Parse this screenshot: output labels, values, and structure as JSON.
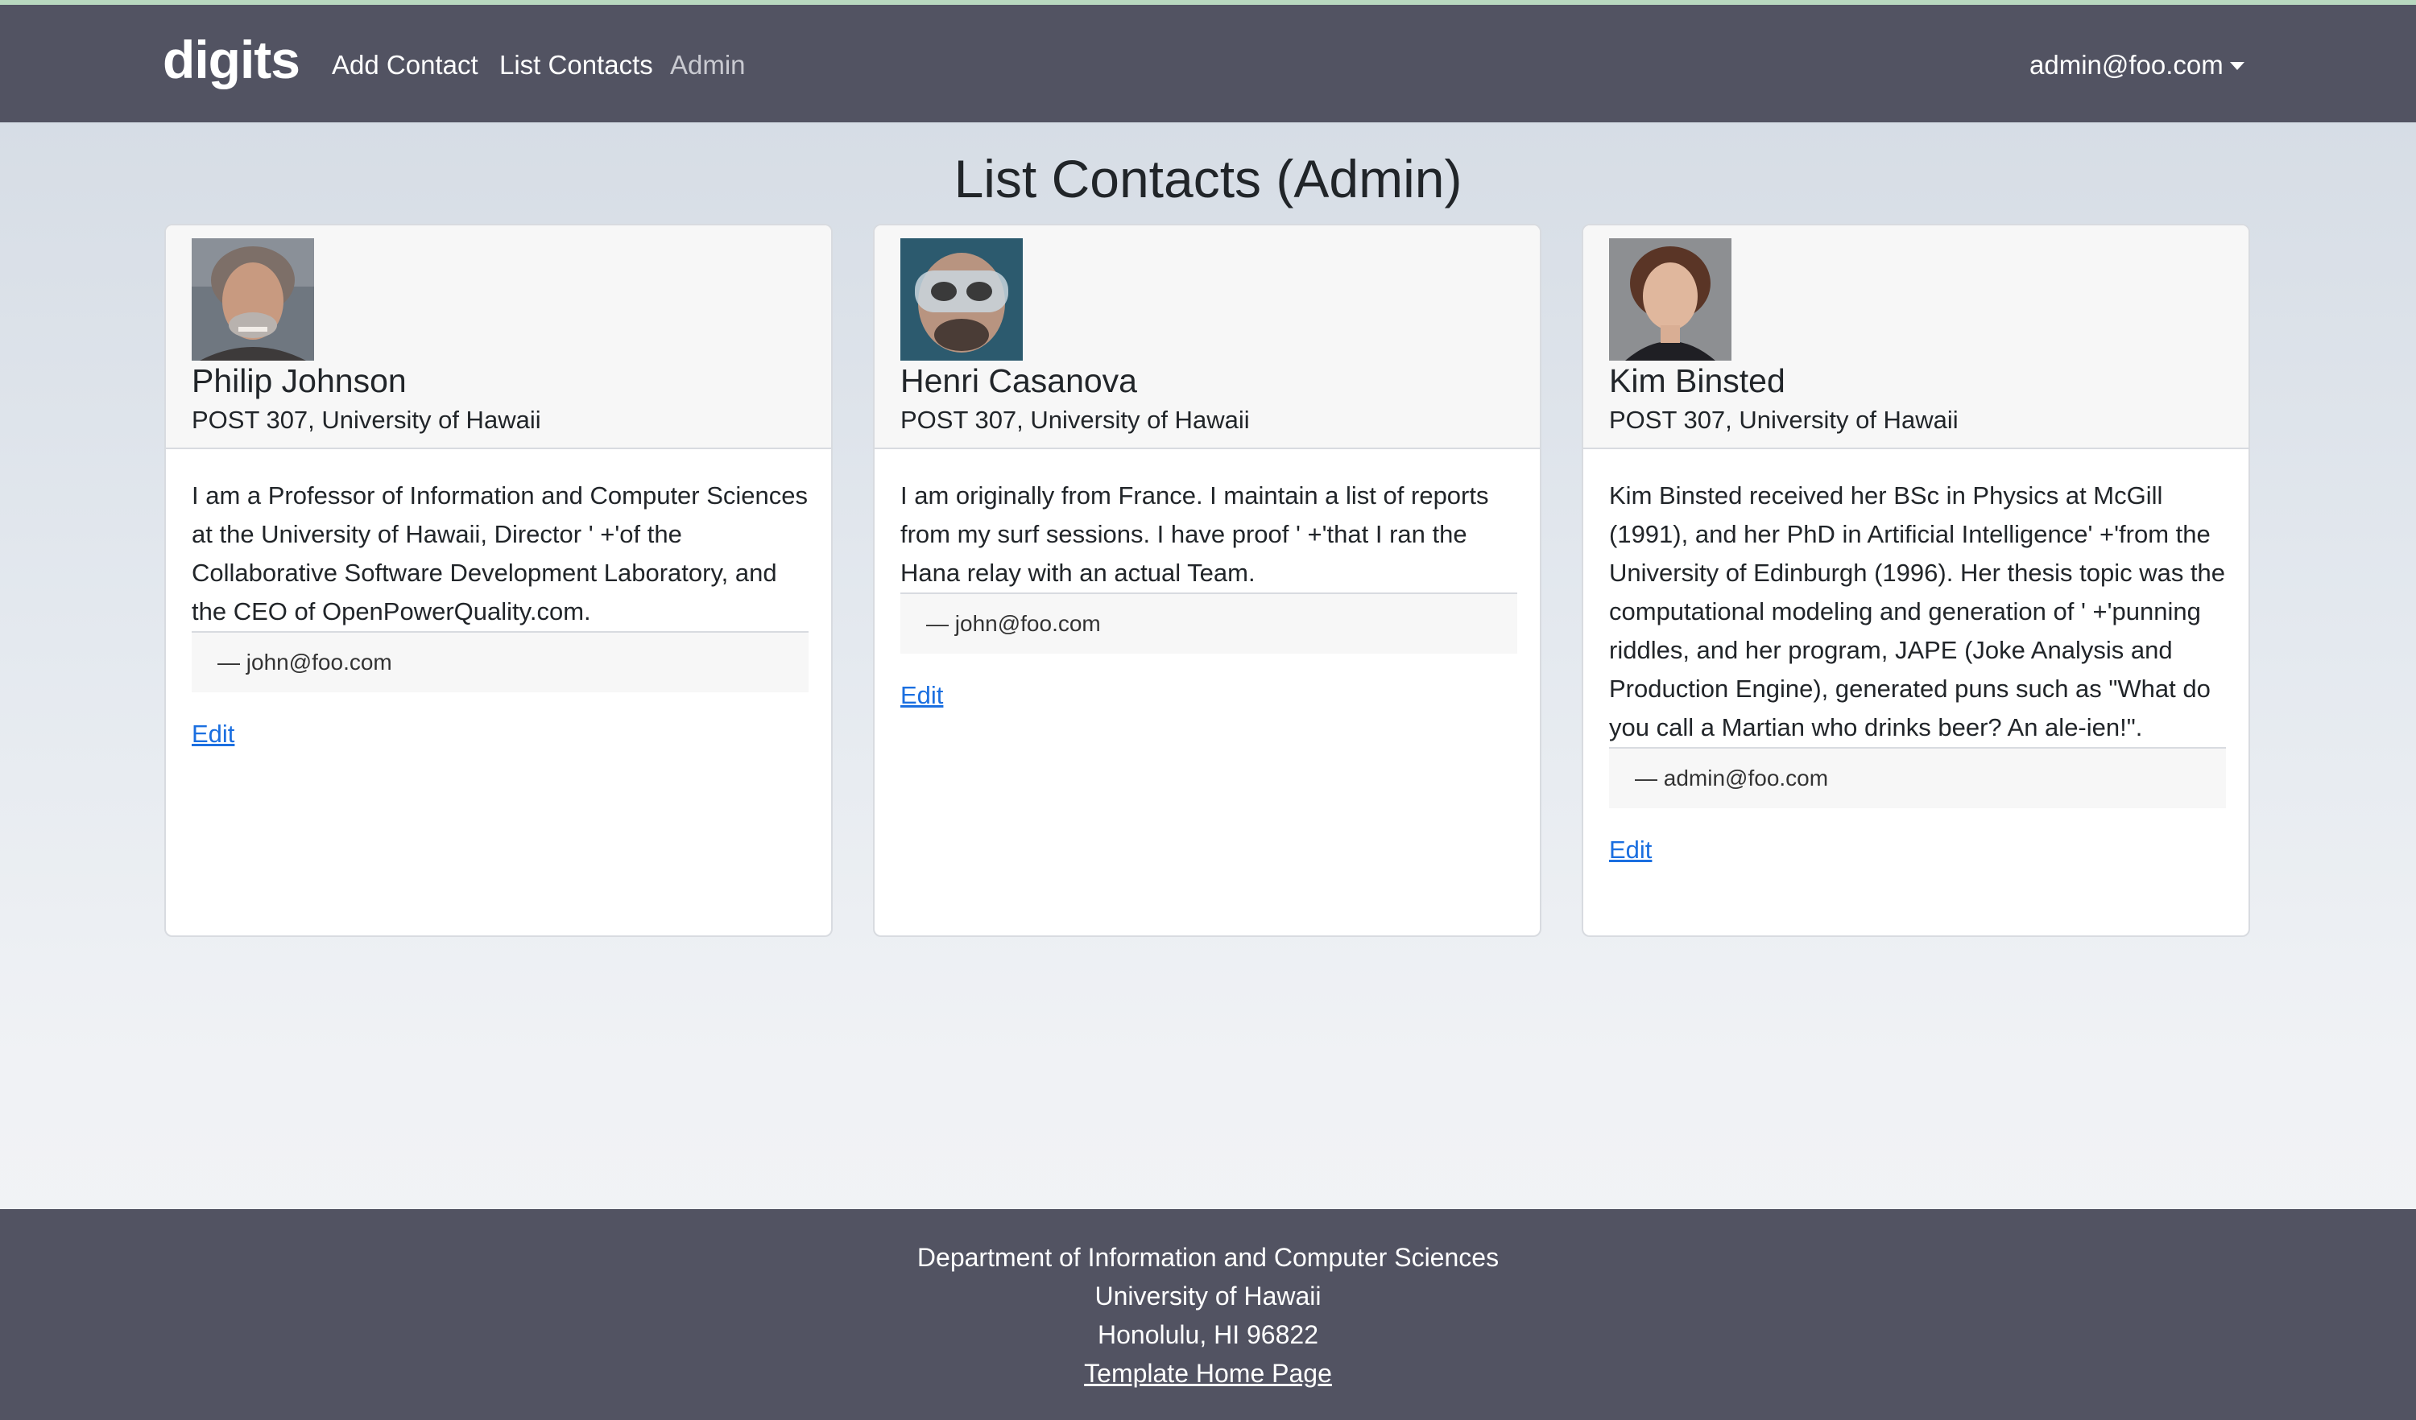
{
  "navbar": {
    "brand": "digits",
    "links": [
      "Add Contact",
      "List Contacts",
      "Admin"
    ],
    "user": "admin@foo.com",
    "colors": {
      "bar": "#525362",
      "inactive_link": "#c9cad1"
    }
  },
  "page": {
    "title": "List Contacts (Admin)"
  },
  "contacts": [
    {
      "name": "Philip Johnson",
      "address": "POST 307, University of Hawaii",
      "description": "I am a Professor of Information and Computer Sciences at the University of Hawaii, Director ' +'of the Collaborative Software Development Laboratory, and the CEO of OpenPowerQuality.com.",
      "note": "— john@foo.com",
      "edit_label": "Edit"
    },
    {
      "name": "Henri Casanova",
      "address": "POST 307, University of Hawaii",
      "description": "I am originally from France. I maintain a list of reports from my surf sessions. I have proof ' +'that I ran the Hana relay with an actual Team.",
      "note": "— john@foo.com",
      "edit_label": "Edit"
    },
    {
      "name": "Kim Binsted",
      "address": "POST 307, University of Hawaii",
      "description": "Kim Binsted received her BSc in Physics at McGill (1991), and her PhD in Artificial Intelligence' +'from the University of Edinburgh (1996). Her thesis topic was the computational modeling and generation of ' +'punning riddles, and her program, JAPE (Joke Analysis and Production Engine), generated puns such as \"What do you call a Martian who drinks beer? An ale-ien!\".",
      "note": "— admin@foo.com",
      "edit_label": "Edit"
    }
  ],
  "footer": {
    "lines": [
      "Department of Information and Computer Sciences",
      "University of Hawaii",
      "Honolulu, HI 96822"
    ],
    "link": "Template Home Page"
  }
}
